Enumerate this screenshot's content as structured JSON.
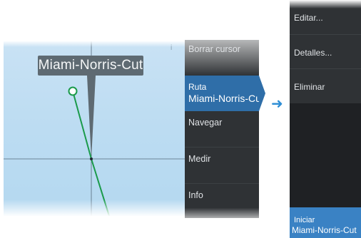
{
  "chart": {
    "route_label": "Miami-Norris-Cut",
    "info_mark": "i"
  },
  "context_menu": {
    "items": [
      {
        "label": "Borrar cursor"
      },
      {
        "label": "Ruta",
        "sublabel": "Miami-Norris-Cut",
        "selected": true
      },
      {
        "label": "Navegar"
      },
      {
        "label": "Medir"
      },
      {
        "label": "Info"
      }
    ]
  },
  "connector_icon": "arrow-right-icon",
  "submenu": {
    "items": [
      {
        "label": "Editar..."
      },
      {
        "label": "Detalles..."
      },
      {
        "label": "Eliminar"
      }
    ],
    "start": {
      "label": "Iniciar",
      "sublabel": "Miami-Norris-Cut"
    }
  },
  "colors": {
    "water": "#bcdcf2",
    "route_line": "#1a9a4a",
    "menu_bg": "#2f3235",
    "selected": "#2f6ea8",
    "accent": "#2f8fd6"
  }
}
